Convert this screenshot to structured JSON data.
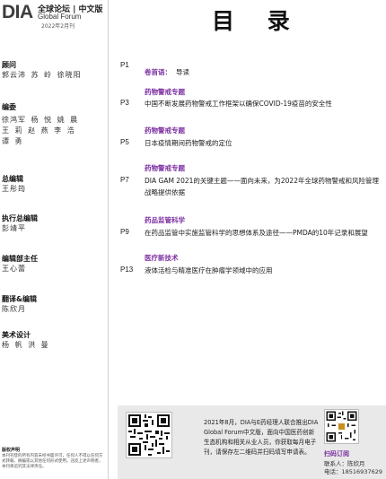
{
  "brand": {
    "logo_text": "DIA",
    "title_cn": "全球论坛 | 中文版",
    "title_en": "Global Forum",
    "issue": "2022年2月刊"
  },
  "page_title": "目 录",
  "sidebar": {
    "sections": [
      {
        "title": "顾问",
        "lines": [
          "郭云沛  苏  岭  徐晓阳"
        ]
      },
      {
        "title": "编委",
        "lines": [
          "徐鸿军  杨  悦  姚  晨",
          "王  莉  赵  燕  李  浩",
          "谭  勇"
        ]
      },
      {
        "title": "总编辑",
        "lines": [
          "王彤筠"
        ]
      },
      {
        "title": "执行总编辑",
        "lines": [
          "彭靖平"
        ]
      },
      {
        "title": "编辑部主任",
        "lines": [
          "王心蕾"
        ]
      },
      {
        "title": "翻译&编辑",
        "lines": [
          "陈欣月"
        ]
      },
      {
        "title": "美术设计",
        "lines": [
          "杨  帆  洪  曼"
        ]
      }
    ],
    "copyright": {
      "title": "版权声明",
      "text": "本刊刊登的所有内容未经书面许可，任何人不得以任何方式转载、摘编或以其他任何形式使用。违反上述声明者，本刊将追究其法律责任。"
    }
  },
  "toc": [
    {
      "page": "P1",
      "category": "卷首语：",
      "text": "导读",
      "inline": true
    },
    {
      "page": "P3",
      "category": "药物警戒专题",
      "text": "中国不断发展药物警戒工作框架以确保COVID-19疫苗的安全性"
    },
    {
      "page": "P5",
      "category": "药物警戒专题",
      "text": "日本疫情期间药物警戒的定位"
    },
    {
      "page": "P7",
      "category": "药物警戒专题",
      "text": "DIA GAM 2021的关键主题——面向未来，为2022年全球药物警戒和风险管理战略提供依据"
    },
    {
      "page": "P9",
      "category": "药品监管科学",
      "text": "在药品监管中实施监管科学的思想体系及途径——PMDA的10年记录和展望"
    },
    {
      "page": "P13",
      "category": "医疗新技术",
      "text": "液体活检与精准医疗在肿瘤学领域中的应用"
    }
  ],
  "footer": {
    "text": "2021年8月，DIA与E药经理人联合推出DIA Global Forum中文版，面向中国医药创新生态机构和相关从业人员，你获取每月电子刊，请保存左二维码并扫码填写申请表。",
    "subscribe_label": "扫码订阅",
    "contact_name": "联系人：陈欣月",
    "contact_phone": "电话：18516937629"
  },
  "colors": {
    "category_purple": "#7b2fa0",
    "footer_gray": "#e9e9e9"
  }
}
